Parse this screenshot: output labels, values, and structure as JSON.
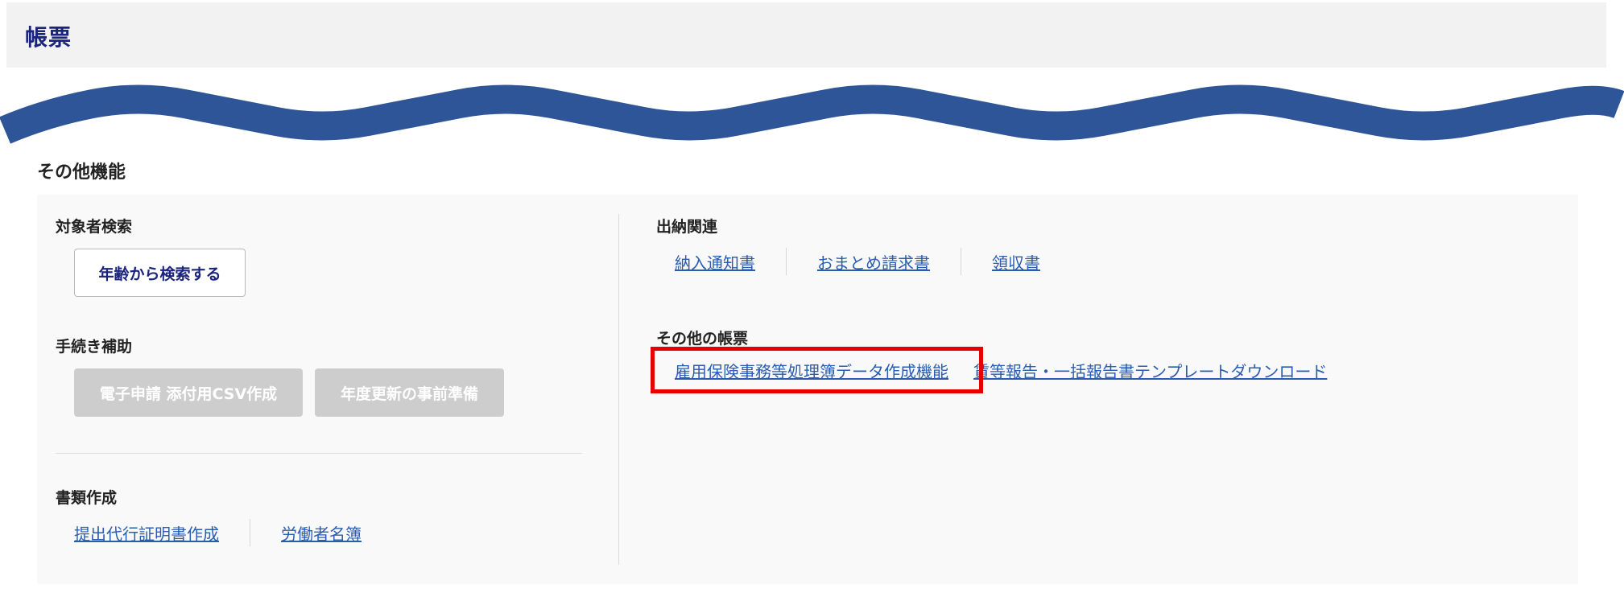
{
  "page": {
    "title": "帳票"
  },
  "section": {
    "title": "その他機能"
  },
  "left": {
    "search": {
      "title": "対象者検索",
      "button": "年齢から検索する"
    },
    "procedure": {
      "title": "手続き補助",
      "buttons": [
        "電子申請 添付用CSV作成",
        "年度更新の事前準備"
      ]
    },
    "documents": {
      "title": "書類作成",
      "links": [
        "提出代行証明書作成",
        "労働者名簿"
      ]
    }
  },
  "right": {
    "payments": {
      "title": "出納関連",
      "links": [
        "納入通知書",
        "おまとめ請求書",
        "領収書"
      ]
    },
    "other_forms": {
      "title": "その他の帳票",
      "links": [
        "雇用保険事務等処理簿データ作成機能",
        "賃等報告・一括報告書テンプレートダウンロード"
      ]
    }
  },
  "colors": {
    "title": "#1a237e",
    "wave": "#2e5597",
    "link": "#2a5db0",
    "highlight": "#e60000",
    "disabled": "#cdcdcd"
  }
}
